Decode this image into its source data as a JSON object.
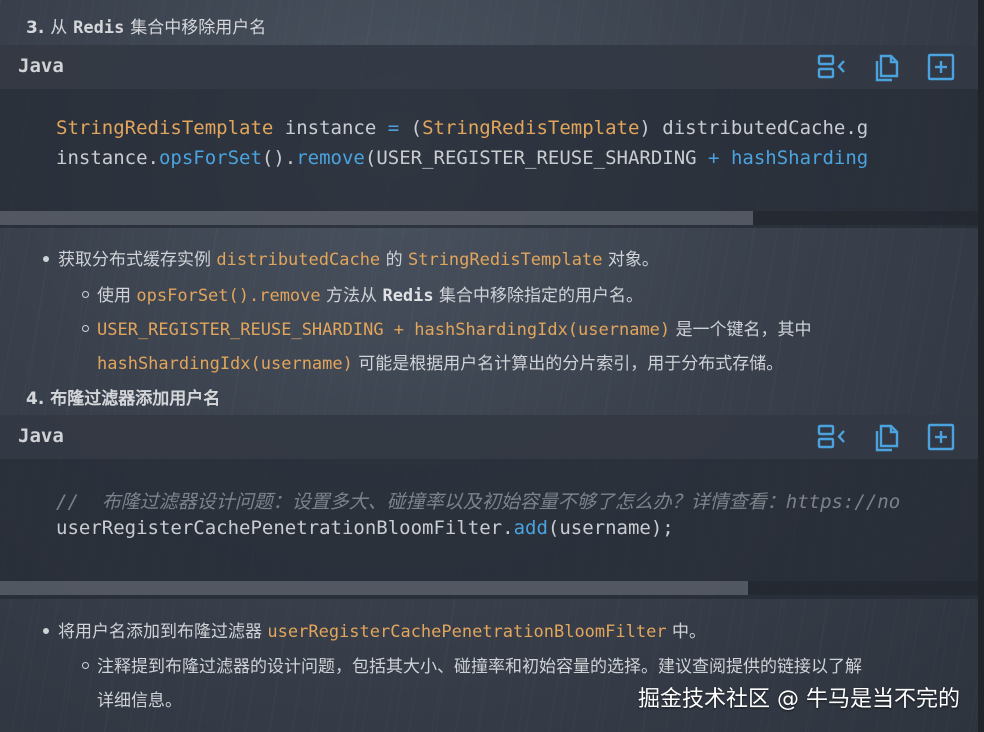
{
  "section3": {
    "number": "3.",
    "title_prefix": "从",
    "title_code": "Redis",
    "title_suffix": "集合中移除用户名"
  },
  "section4": {
    "number": "4.",
    "title": "布隆过滤器添加用户名"
  },
  "code_block_1": {
    "language": "Java",
    "lines": [
      {
        "t1": "StringRedisTemplate",
        "t2": " instance ",
        "t3": "=",
        "t4": " (",
        "t5": "StringRedisTemplate",
        "t6": ") distributedCache.g"
      },
      {
        "t1": "instance.",
        "t2": "opsForSet",
        "t3": "().",
        "t4": "remove",
        "t5": "(USER_REGISTER_REUSE_SHARDING ",
        "t6": "+",
        "t7": " hashSharding"
      }
    ],
    "scroll_fraction": 0.77
  },
  "code_block_2": {
    "language": "Java",
    "lines": [
      {
        "comment": "//  布隆过滤器设计问题：设置多大、碰撞率以及初始容量不够了怎么办？详情查看：https://no"
      },
      {
        "t1": "userRegisterCachePenetrationBloomFilter.",
        "t2": "add",
        "t3": "(username);"
      }
    ],
    "scroll_fraction": 0.765
  },
  "toolbar": {
    "icons": [
      "wrap-lines-icon",
      "copy-icon",
      "add-box-icon"
    ]
  },
  "explain3": {
    "b1_prefix": "获取分布式缓存实例",
    "b1_code1": "distributedCache",
    "b1_mid": "的",
    "b1_code2": "StringRedisTemplate",
    "b1_suffix": "对象。",
    "b2_prefix": "使用",
    "b2_code": "opsForSet().remove",
    "b2_mid": "方法从",
    "b2_bold": "Redis",
    "b2_suffix": "集合中移除指定的用户名。",
    "b3_code": "USER_REGISTER_REUSE_SHARDING + hashShardingIdx(username)",
    "b3_suffix": "是一个键名，其中",
    "b3_code2": "hashShardingIdx(username)",
    "b3_suffix2": "可能是根据用户名计算出的分片索引，用于分布式存储。"
  },
  "explain4": {
    "b1_prefix": "将用户名添加到布隆过滤器",
    "b1_code": "userRegisterCachePenetrationBloomFilter",
    "b1_suffix": "中。",
    "b2_line1": "注释提到布隆过滤器的设计问题，包括其大小、碰撞率和初始容量的选择。建议查阅提供的链接以了解",
    "b2_line2": "详细信息。"
  },
  "watermark": "掘金技术社区 @ 牛马是当不完的",
  "colors": {
    "accent": "#4aa3df",
    "code_type": "#e2a55c",
    "comment": "#7d828a"
  }
}
